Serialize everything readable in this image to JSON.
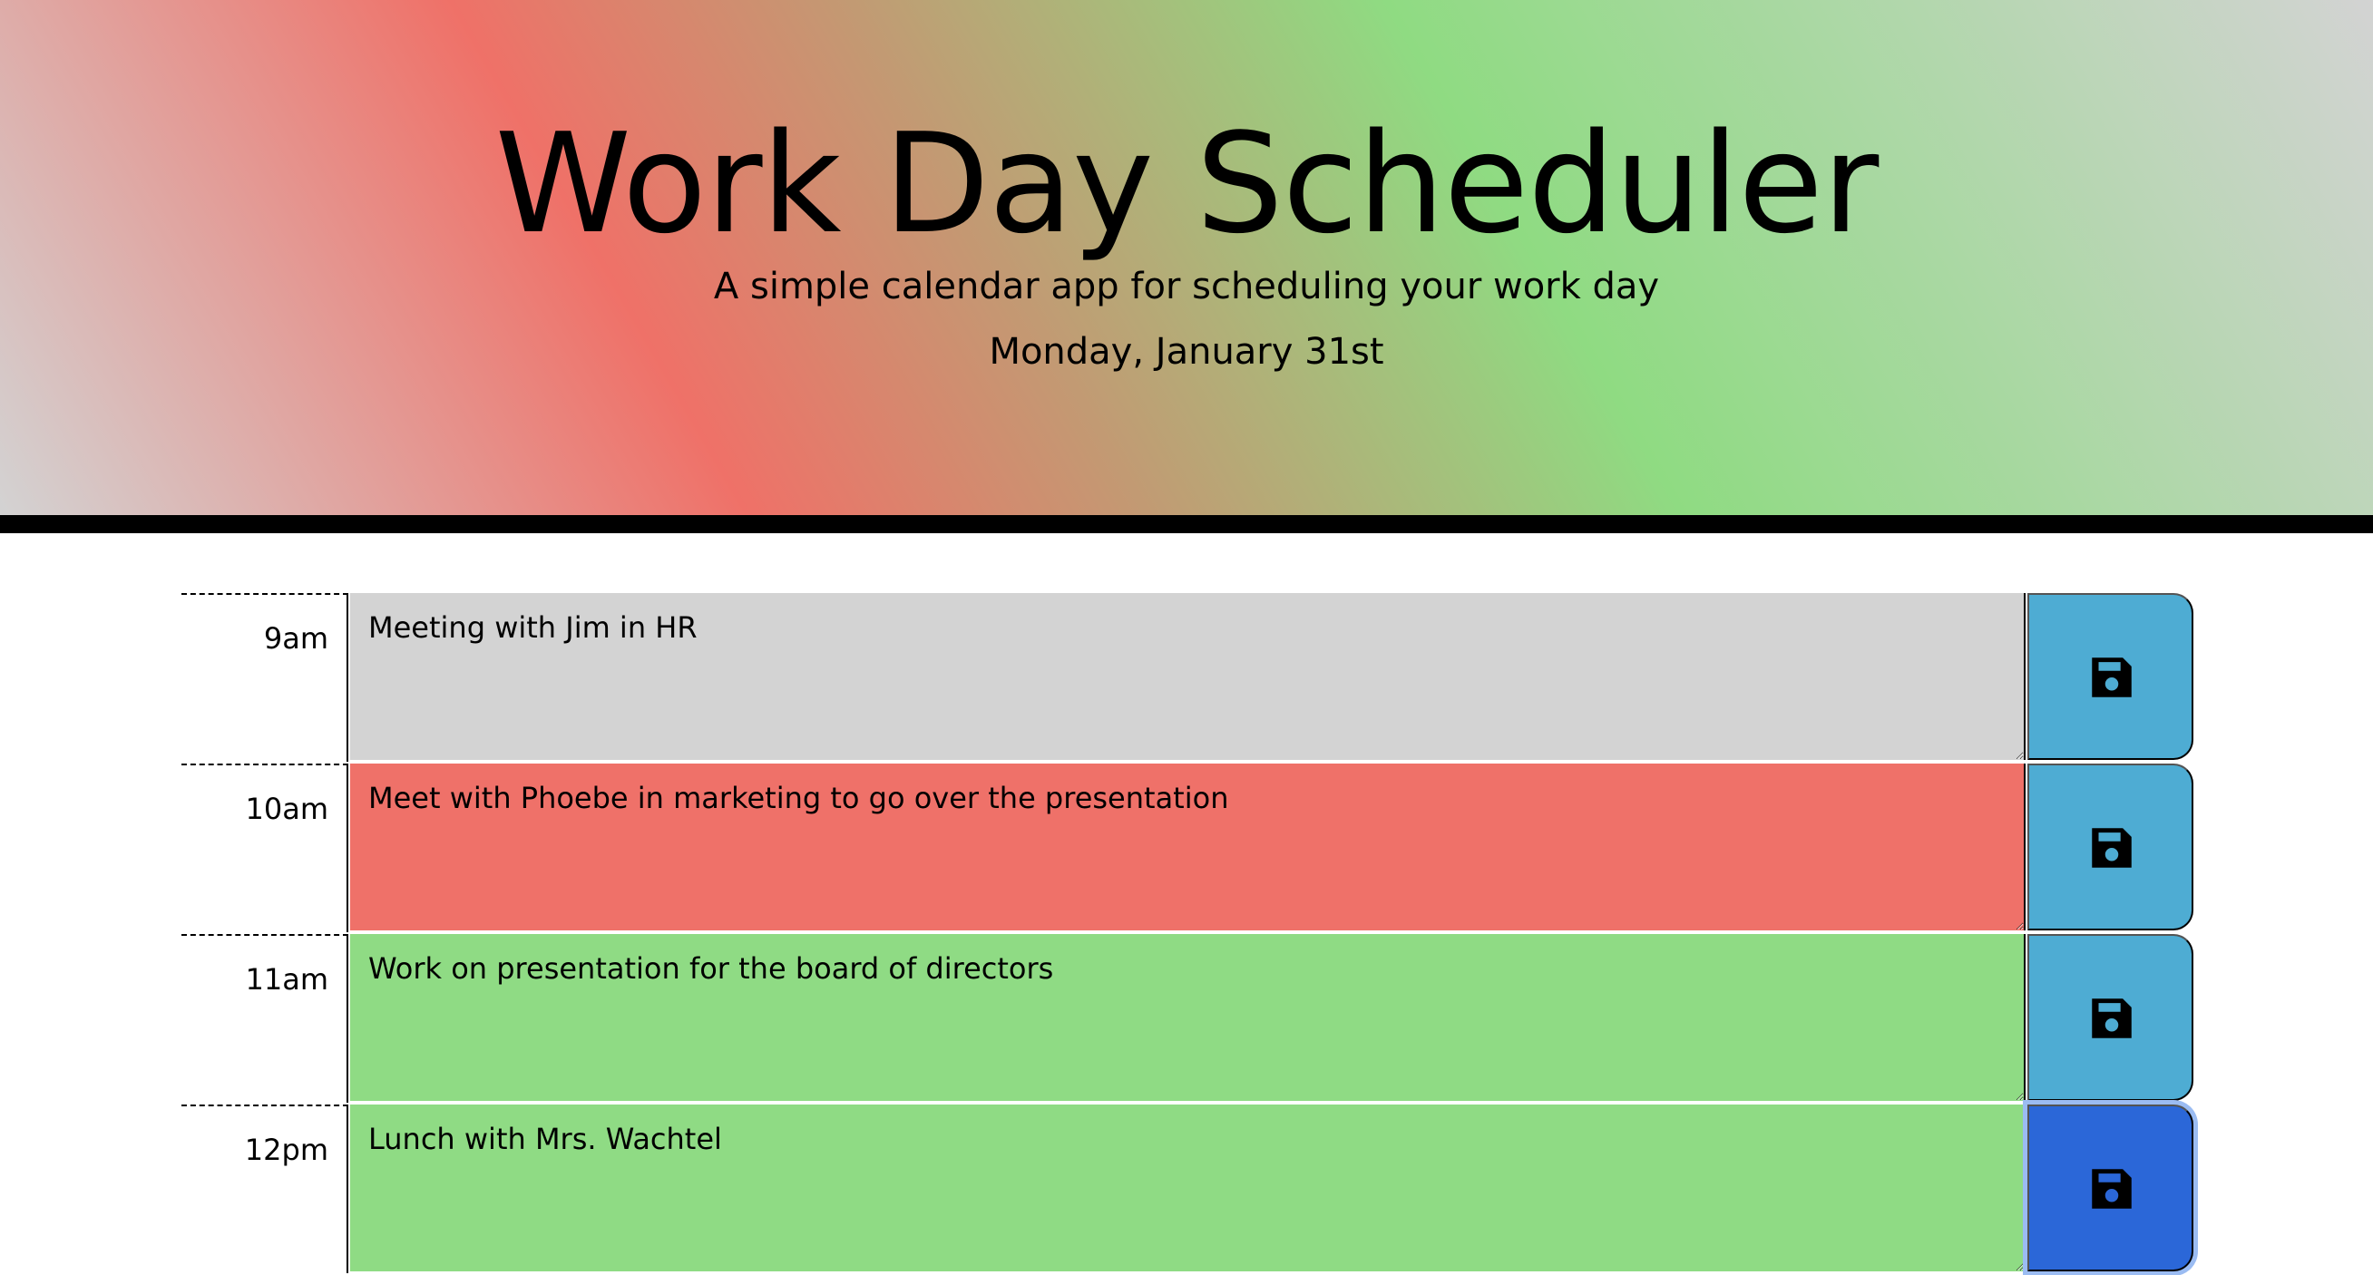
{
  "header": {
    "title": "Work Day Scheduler",
    "subtitle": "A simple calendar app for scheduling your work day",
    "current_day": "Monday, January 31st"
  },
  "colors": {
    "past": "#d3d3d3",
    "present": "#ef7169",
    "future": "#8fdb84",
    "save_button": "#4eacd3",
    "save_button_active": "#2b67d8"
  },
  "time_blocks": [
    {
      "hour": "9am",
      "text": "Meeting with Jim in HR",
      "status": "past",
      "save_icon": "floppy-disk-icon"
    },
    {
      "hour": "10am",
      "text": "Meet with Phoebe in marketing to go over the presentation",
      "status": "present",
      "save_icon": "floppy-disk-icon"
    },
    {
      "hour": "11am",
      "text": "Work on presentation for the board of directors",
      "status": "future",
      "save_icon": "floppy-disk-icon"
    },
    {
      "hour": "12pm",
      "text": "Lunch with Mrs. Wachtel",
      "status": "future",
      "save_icon": "floppy-disk-icon"
    }
  ]
}
